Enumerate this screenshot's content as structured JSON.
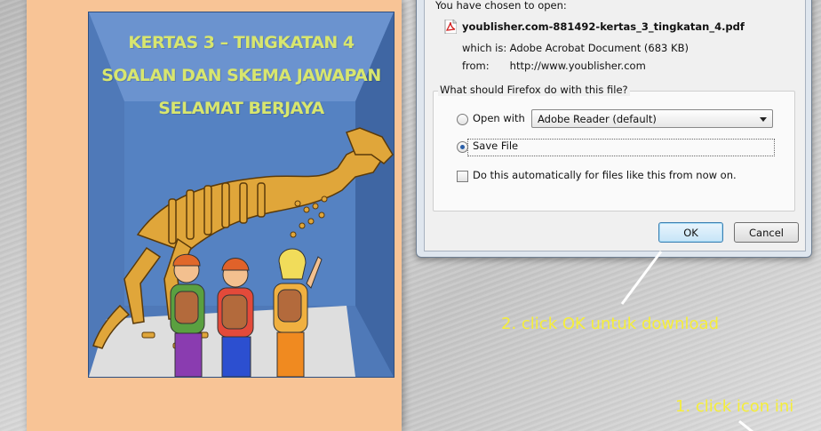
{
  "book": {
    "title_lines": [
      "KERTAS 3 – TINGKATAN 4",
      "SOALAN DAN SKEMA JAWAPAN",
      "SELAMAT BERJAYA"
    ]
  },
  "dialog": {
    "chosen_label": "You have chosen to open:",
    "file_name": "youblisher.com-881492-kertas_3_tingkatan_4.pdf",
    "which_is_key": "which is:",
    "which_is_value": "Adobe Acrobat Document (683 KB)",
    "from_key": "from:",
    "from_value": "http://www.youblisher.com",
    "question": "What should Firefox do with this file?",
    "open_with_label": "Open with",
    "open_with_value": "Adobe Reader  (default)",
    "save_file_label": "Save File",
    "auto_label": "Do this automatically for files like this from now on.",
    "selected_option": "save_file",
    "auto_checked": false,
    "ok_label": "OK",
    "cancel_label": "Cancel"
  },
  "annotations": {
    "step2": "2. click OK untuk download",
    "step1": "1. click icon ini",
    "color": "#f5ee3a"
  },
  "colors": {
    "book_background": "#f8c496",
    "cover_blue": "#4f79b8",
    "title_green": "#d8e66e"
  },
  "icons": [
    "pdf-icon",
    "radio-icon",
    "dropdown-arrow-icon",
    "checkbox-icon",
    "pointer-line-icon"
  ]
}
